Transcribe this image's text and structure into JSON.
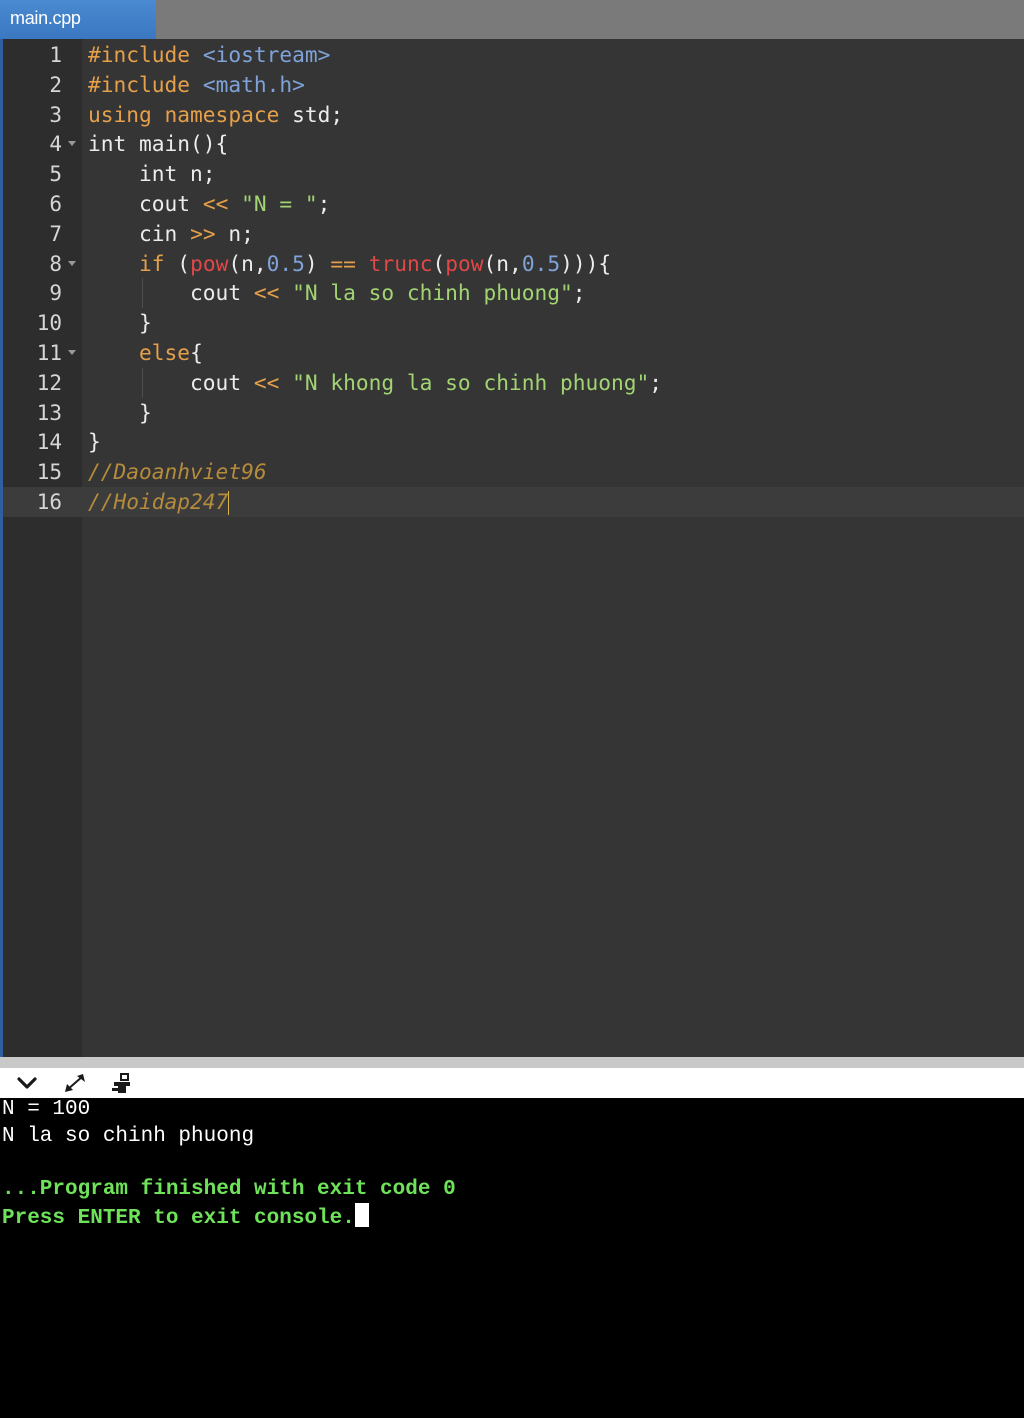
{
  "tab": {
    "label": "main.cpp"
  },
  "editor": {
    "lines": [
      {
        "n": "1",
        "tokens": [
          [
            "kw",
            "#include "
          ],
          [
            "hd",
            "<iostream>"
          ]
        ]
      },
      {
        "n": "2",
        "tokens": [
          [
            "kw",
            "#include "
          ],
          [
            "hd",
            "<math.h>"
          ]
        ]
      },
      {
        "n": "3",
        "tokens": [
          [
            "kw",
            "using namespace "
          ],
          [
            "pl",
            "std;"
          ]
        ]
      },
      {
        "n": "4",
        "fold": true,
        "tokens": [
          [
            "pl",
            "int main(){"
          ]
        ]
      },
      {
        "n": "5",
        "tokens": [
          [
            "pl",
            "    int n;"
          ]
        ]
      },
      {
        "n": "6",
        "tokens": [
          [
            "pl",
            "    cout "
          ],
          [
            "op",
            "<< "
          ],
          [
            "st",
            "\"N = \""
          ],
          [
            "pl",
            ";"
          ]
        ]
      },
      {
        "n": "7",
        "tokens": [
          [
            "pl",
            "    cin "
          ],
          [
            "op",
            ">> "
          ],
          [
            "pl",
            "n;"
          ]
        ]
      },
      {
        "n": "8",
        "fold": true,
        "tokens": [
          [
            "kw",
            "    if "
          ],
          [
            "pl",
            "("
          ],
          [
            "fn",
            "pow"
          ],
          [
            "pl",
            "(n,"
          ],
          [
            "nm",
            "0.5"
          ],
          [
            "pl",
            ") "
          ],
          [
            "op",
            "== "
          ],
          [
            "fn",
            "trunc"
          ],
          [
            "pl",
            "("
          ],
          [
            "fn",
            "pow"
          ],
          [
            "pl",
            "(n,"
          ],
          [
            "nm",
            "0.5"
          ],
          [
            "pl",
            ")))"
          ],
          [
            "pl",
            "{"
          ]
        ]
      },
      {
        "n": "9",
        "guide": true,
        "tokens": [
          [
            "pl",
            "        cout "
          ],
          [
            "op",
            "<< "
          ],
          [
            "st",
            "\"N la so chinh phuong\""
          ],
          [
            "pl",
            ";"
          ]
        ]
      },
      {
        "n": "10",
        "tokens": [
          [
            "pl",
            "    }"
          ]
        ]
      },
      {
        "n": "11",
        "fold": true,
        "tokens": [
          [
            "kw",
            "    else"
          ],
          [
            "pl",
            "{"
          ]
        ]
      },
      {
        "n": "12",
        "guide": true,
        "tokens": [
          [
            "pl",
            "        cout "
          ],
          [
            "op",
            "<< "
          ],
          [
            "st",
            "\"N khong la so chinh phuong\""
          ],
          [
            "pl",
            ";"
          ]
        ]
      },
      {
        "n": "13",
        "tokens": [
          [
            "pl",
            "    }"
          ]
        ]
      },
      {
        "n": "14",
        "tokens": [
          [
            "pl",
            "}"
          ]
        ]
      },
      {
        "n": "15",
        "tokens": [
          [
            "cm",
            "//Daoanhviet96"
          ]
        ]
      },
      {
        "n": "16",
        "active": true,
        "caret": true,
        "tokens": [
          [
            "cm",
            "//Hoidap247"
          ]
        ]
      }
    ]
  },
  "console_toolbar": {
    "icons": [
      "chevron-down-icon",
      "expand-icon",
      "settings-icon"
    ]
  },
  "console": {
    "output_line_1": "N = 100",
    "output_line_2": "N la so chinh phuong",
    "status_line_1": "...Program finished with exit code 0",
    "status_line_2": "Press ENTER to exit console."
  },
  "colors": {
    "keyword": "#e6a04a",
    "string": "#a2d474",
    "number": "#7fa3d8",
    "function": "#e04848",
    "comment": "#b58b3c",
    "console_status": "#6ee35a",
    "tab_active": "#3a78c2"
  }
}
